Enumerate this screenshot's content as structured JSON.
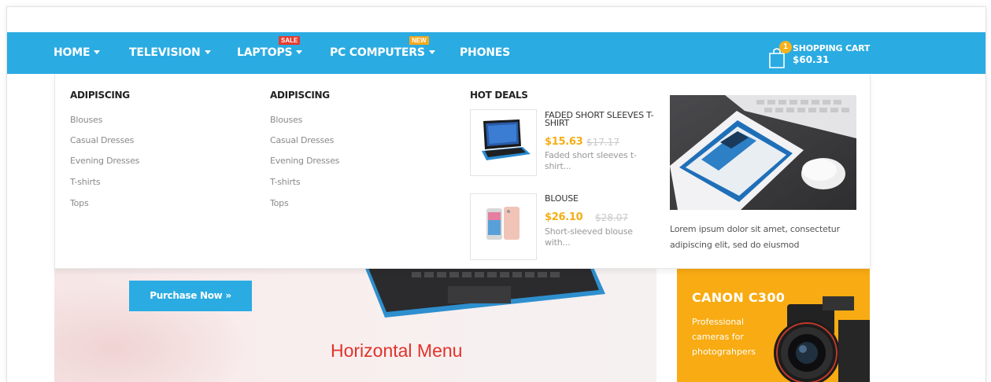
{
  "nav": {
    "items": [
      {
        "label": "HOME",
        "has_dropdown": true
      },
      {
        "label": "TELEVISION",
        "has_dropdown": true
      },
      {
        "label": "LAPTOPS",
        "has_dropdown": true,
        "badge": "SALE"
      },
      {
        "label": "PC COMPUTERS",
        "has_dropdown": true,
        "badge": "NEW"
      },
      {
        "label": "PHONES",
        "has_dropdown": false
      }
    ],
    "cart": {
      "count": "1",
      "label": "SHOPPING CART",
      "total": "$60.31"
    }
  },
  "colors": {
    "nav_bg": "#2aabe2",
    "sale_badge": "#e63b2e",
    "new_badge": "#f6a91d",
    "price": "#f4ad15",
    "promo_bg": "#f8ab12",
    "caption": "#e2322b"
  },
  "dropdown": {
    "columns": [
      {
        "title": "ADIPISCING",
        "links": [
          "Blouses",
          "Casual Dresses",
          "Evening Dresses",
          "T-shirts",
          "Tops"
        ]
      },
      {
        "title": "ADIPISCING",
        "links": [
          "Blouses",
          "Casual Dresses",
          "Evening Dresses",
          "T-shirts",
          "Tops"
        ]
      }
    ],
    "hot_deals": {
      "title": "HOT DEALS",
      "items": [
        {
          "name": "FADED SHORT SLEEVES T-SHIRT",
          "price": "$15.63",
          "old_price": "$17.17",
          "desc": "Faded short sleeves t-shirt..."
        },
        {
          "name": "BLOUSE",
          "price": "$26.10",
          "old_price": "$28.07",
          "desc": "Short-sleeved blouse with..."
        }
      ]
    },
    "banner": {
      "text": "Lorem ipsum dolor sit amet, consectetur adipiscing elit, sed do eiusmod"
    }
  },
  "hero": {
    "button": "Purchase Now »",
    "caption": "Horizontal Menu"
  },
  "promo": {
    "title": "CANON C300",
    "text": "Professional cameras for photograhpers"
  }
}
